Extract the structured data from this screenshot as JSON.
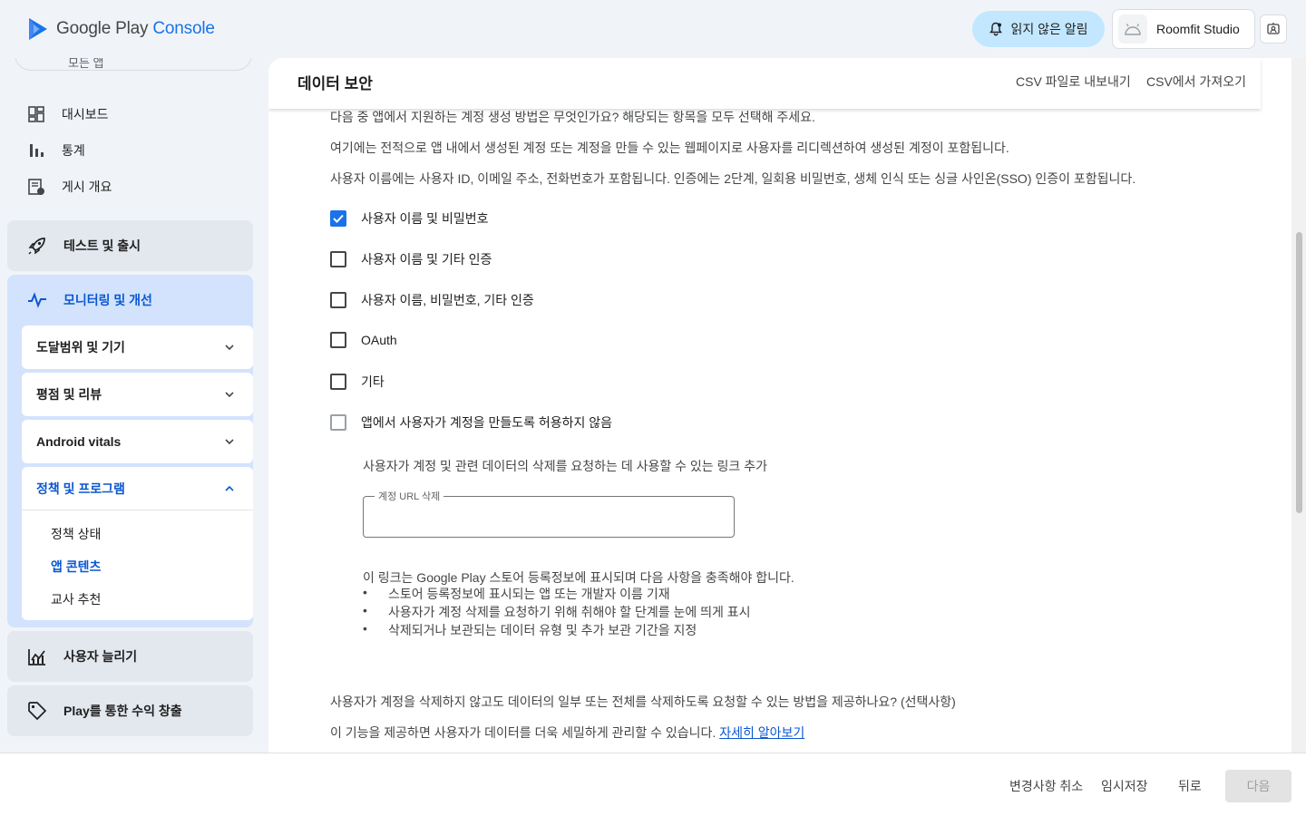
{
  "brand": {
    "name": "Google Play",
    "suffix": "Console"
  },
  "topbar": {
    "notifications_label": "읽지 않은 알림",
    "account_name": "Roomfit Studio"
  },
  "sidebar": {
    "search_stub": "모든 앱",
    "nav": {
      "dashboard": "대시보드",
      "stats": "통계",
      "publishing": "게시 개요"
    },
    "groups": {
      "test_release": "테스트 및 출시",
      "monitor": "모니터링 및 개선",
      "grow_users": "사용자 늘리기",
      "monetize": "Play를 통한 수익 창출"
    },
    "sub": {
      "reach": "도달범위 및 기기",
      "ratings": "평점 및 리뷰",
      "vitals": "Android vitals",
      "policy": "정책 및 프로그램"
    },
    "policy_items": {
      "status": "정책 상태",
      "app_content": "앱 콘텐츠",
      "teacher": "교사 추천"
    }
  },
  "header": {
    "title": "데이터 보안",
    "export_csv": "CSV 파일로 내보내기",
    "import_csv": "CSV에서 가져오기"
  },
  "content": {
    "question": "다음 중 앱에서 지원하는 계정 생성 방법은 무엇인가요? 해당되는 항목을 모두 선택해 주세요.",
    "desc1": "여기에는 전적으로 앱 내에서 생성된 계정 또는 계정을 만들 수 있는 웹페이지로 사용자를 리디렉션하여 생성된 계정이 포함됩니다.",
    "desc2": "사용자 이름에는 사용자 ID, 이메일 주소, 전화번호가 포함됩니다. 인증에는 2단계, 일회용 비밀번호, 생체 인식 또는 싱글 사인온(SSO) 인증이 포함됩니다.",
    "options": [
      {
        "label": "사용자 이름 및 비밀번호",
        "checked": true
      },
      {
        "label": "사용자 이름 및 기타 인증",
        "checked": false
      },
      {
        "label": "사용자 이름, 비밀번호, 기타 인증",
        "checked": false
      },
      {
        "label": "OAuth",
        "checked": false
      },
      {
        "label": "기타",
        "checked": false
      },
      {
        "label": "앱에서 사용자가 계정을 만들도록 허용하지 않음",
        "checked": false
      }
    ],
    "deletion_prompt": "사용자가 계정 및 관련 데이터의 삭제를 요청하는 데 사용할 수 있는 링크 추가",
    "url_field": {
      "label": "계정 URL 삭제",
      "value": ""
    },
    "link_note": "이 링크는 Google Play 스토어 등록정보에 표시되며 다음 사항을 충족해야 합니다.",
    "requirements": [
      "스토어 등록정보에 표시되는 앱 또는 개발자 이름 기재",
      "사용자가 계정 삭제를 요청하기 위해 취해야 할 단계를 눈에 띄게 표시",
      "삭제되거나 보관되는 데이터 유형 및 추가 보관 기간을 지정"
    ],
    "partial_question": "사용자가 계정을 삭제하지 않고도 데이터의 일부 또는 전체를 삭제하도록 요청할 수 있는 방법을 제공하나요? (선택사항)",
    "partial_desc": "이 기능을 제공하면 사용자가 데이터를 더욱 세밀하게 관리할 수 있습니다.",
    "learn_more": "자세히 알아보기"
  },
  "footer": {
    "discard": "변경사항 취소",
    "save_draft": "임시저장",
    "back": "뒤로",
    "next": "다음"
  },
  "colors": {
    "accent": "#0b57d0",
    "checkbox": "#1a73e8",
    "notif_bg": "#c2e7ff",
    "sidebar_active": "#d3e3fd"
  }
}
